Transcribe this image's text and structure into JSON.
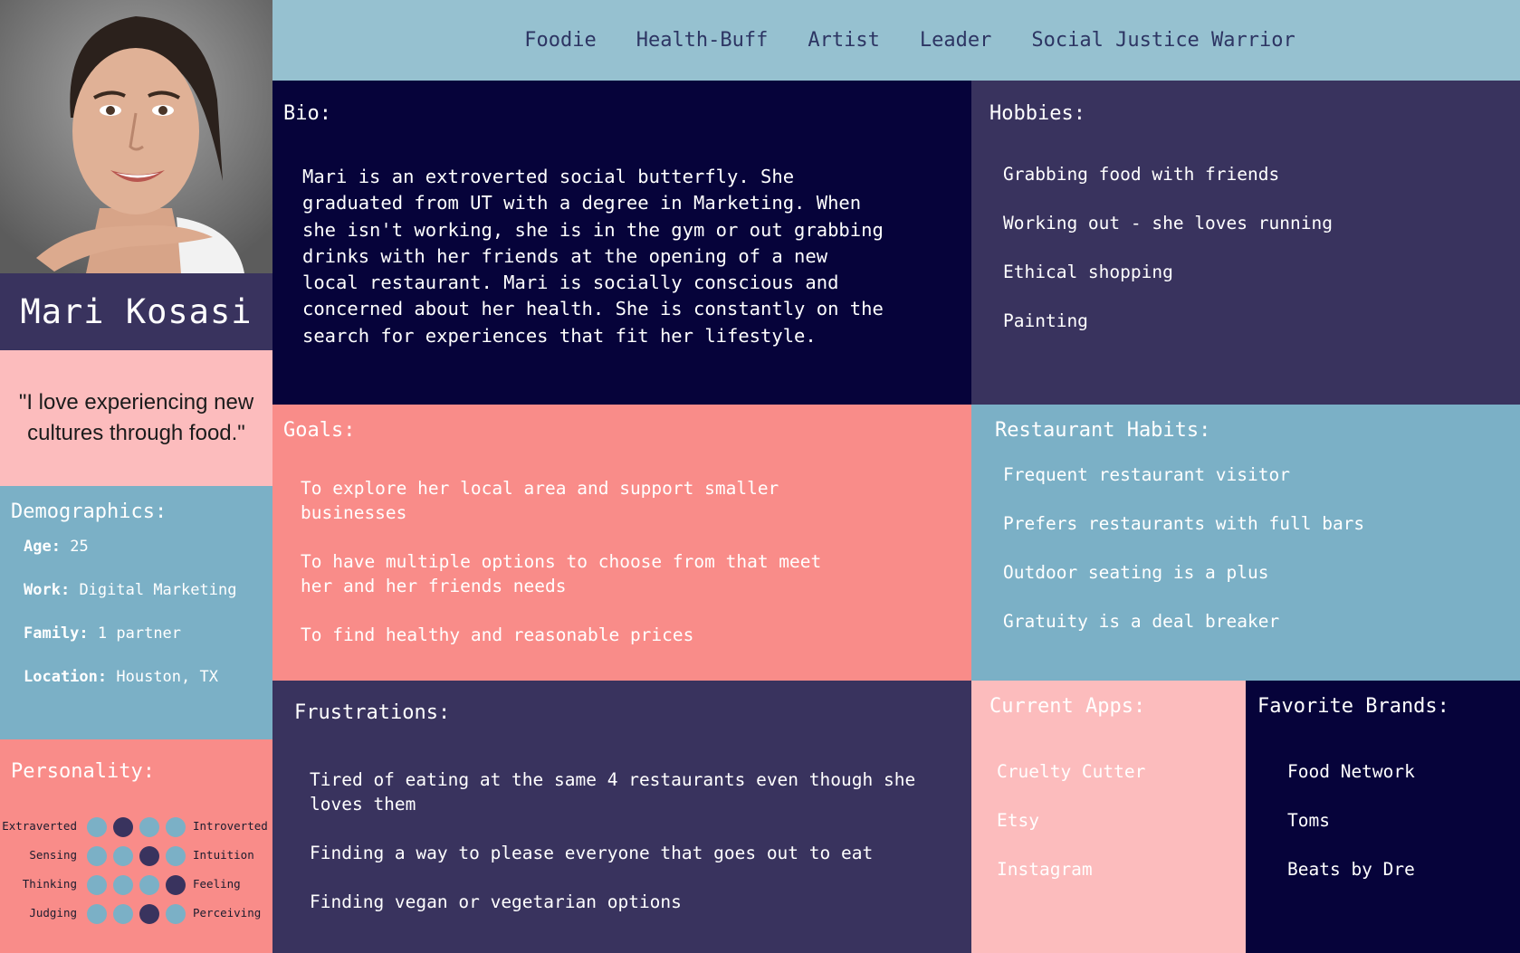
{
  "persona": {
    "name": "Mari Kosasi",
    "quote": "\"I love experiencing new cultures through food.\""
  },
  "nav": [
    "Foodie",
    "Health-Buff",
    "Artist",
    "Leader",
    "Social Justice Warrior"
  ],
  "bio": {
    "heading": "Bio:",
    "lines": [
      "Mari is an extroverted social butterfly. She",
      "graduated from UT with a degree in Marketing. When",
      "she isn't working, she is in the gym or out grabbing",
      "drinks with her friends at the opening of a new",
      "local restaurant. Mari is socially conscious and",
      "concerned about her health. She is constantly on the",
      "search for experiences that fit her lifestyle."
    ]
  },
  "hobbies": {
    "heading": "Hobbies:",
    "items": [
      "Grabbing food with friends",
      "Working out - she loves running",
      "Ethical shopping",
      "Painting"
    ]
  },
  "goals": {
    "heading": "Goals:",
    "items": [
      {
        "line1": "To explore her local area and support smaller",
        "line2": "businesses"
      },
      {
        "line1": "To have multiple options to choose from that meet",
        "line2": "her and her friends needs"
      },
      {
        "line1": "To find healthy and reasonable prices",
        "line2": ""
      }
    ]
  },
  "habits": {
    "heading": "Restaurant Habits:",
    "items": [
      "Frequent restaurant visitor",
      "Prefers restaurants with full bars",
      "Outdoor seating is a plus",
      "Gratuity is a deal breaker"
    ]
  },
  "demographics": {
    "heading": "Demographics:",
    "rows": [
      {
        "label": "Age:",
        "value": "25"
      },
      {
        "label": "Work:",
        "value": "Digital Marketing"
      },
      {
        "label": "Family:",
        "value": "1 partner"
      },
      {
        "label": "Location:",
        "value": "Houston, TX"
      }
    ]
  },
  "personality": {
    "heading": "Personality:",
    "traits": [
      {
        "left": "Extraverted",
        "right": "Introverted",
        "selected": 2
      },
      {
        "left": "Sensing",
        "right": "Intuition",
        "selected": 3
      },
      {
        "left": "Thinking",
        "right": "Feeling",
        "selected": 4
      },
      {
        "left": "Judging",
        "right": "Perceiving",
        "selected": 3
      }
    ]
  },
  "frustrations": {
    "heading": "Frustrations:",
    "items": [
      {
        "line1": "Tired of eating at the same 4 restaurants even though she",
        "line2": "loves them"
      },
      {
        "line1": "Finding a way to please everyone that goes out to eat",
        "line2": ""
      },
      {
        "line1": "Finding vegan or vegetarian options",
        "line2": ""
      }
    ]
  },
  "apps": {
    "heading": "Current Apps:",
    "items": [
      "Cruelty Cutter",
      "Etsy",
      "Instagram"
    ]
  },
  "brands": {
    "heading": "Favorite Brands:",
    "items": [
      "Food Network",
      "Toms",
      "Beats by Dre"
    ]
  },
  "colors": {
    "navy": "#06033a",
    "indigo": "#39335e",
    "salmon": "#f98c89",
    "blue": "#7bb0c6",
    "pink": "#fcbcbd",
    "nav_bg": "#96c1d0"
  }
}
